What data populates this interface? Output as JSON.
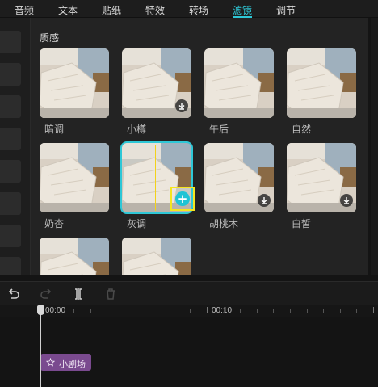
{
  "tabs": [
    {
      "label": "音频"
    },
    {
      "label": "文本"
    },
    {
      "label": "贴纸"
    },
    {
      "label": "特效"
    },
    {
      "label": "转场"
    },
    {
      "label": "滤镜",
      "active": true
    },
    {
      "label": "调节"
    }
  ],
  "panel": {
    "section_title": "质感",
    "filters": [
      {
        "name": "暗调",
        "download": false
      },
      {
        "name": "小樽",
        "download": true
      },
      {
        "name": "午后",
        "download": false
      },
      {
        "name": "自然",
        "download": false
      },
      {
        "name": "奶杏",
        "download": false
      },
      {
        "name": "灰调",
        "download": false,
        "selected": true
      },
      {
        "name": "胡桃木",
        "download": true
      },
      {
        "name": "白皙",
        "download": true
      },
      {
        "name": "",
        "download": false
      },
      {
        "name": "",
        "download": false
      }
    ],
    "add_symbol": "+"
  },
  "timeline": {
    "time_labels": [
      "00:00",
      "00:10"
    ],
    "clip_label": "小剧场"
  },
  "icons": {
    "undo": "undo-icon",
    "redo": "redo-icon",
    "split": "split-icon",
    "delete": "trash-icon",
    "download": "download-icon",
    "add": "plus-icon",
    "clip": "star-icon"
  },
  "colors": {
    "accent": "#2ec7d6",
    "highlight_box": "#f5e61f",
    "clip": "#7a4a8f",
    "panel_bg": "#232323"
  }
}
